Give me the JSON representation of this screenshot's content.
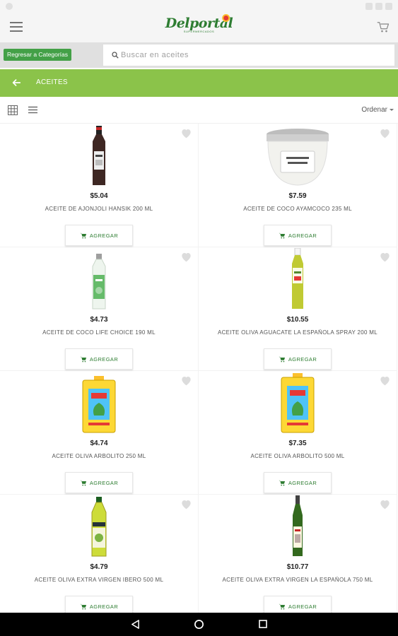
{
  "app": {
    "logo_text": "Delportal",
    "logo_subtitle": "SUPERMERCADOS"
  },
  "header": {
    "menu_icon": "hamburger-menu-icon",
    "cart_icon": "shopping-cart-icon"
  },
  "search": {
    "back_to_categories_label": "Regresar a Categorías",
    "placeholder": "Buscar en aceites",
    "value": ""
  },
  "category": {
    "title": "ACEITES",
    "back_icon": "arrow-left-icon"
  },
  "toolbar": {
    "grid_view_icon": "grid-view-icon",
    "list_view_icon": "list-view-icon",
    "sort_label": "Ordenar"
  },
  "products": [
    {
      "price": "$5.04",
      "name": "ACEITE DE AJONJOLI HANSIK 200 ML",
      "add_label": "AGREGAR",
      "image": "dark-glass-bottle"
    },
    {
      "price": "$7.59",
      "name": "ACEITE DE COCO AYAMCOCO 235 ML",
      "add_label": "AGREGAR",
      "image": "coconut-oil-jar"
    },
    {
      "price": "$4.73",
      "name": "ACEITE DE COCO LIFE CHOICE 190 ML",
      "add_label": "AGREGAR",
      "image": "clear-bottle-green-label"
    },
    {
      "price": "$10.55",
      "name": "ACEITE OLIVA AGUACATE LA ESPAÑOLA SPRAY 200 ML",
      "add_label": "AGREGAR",
      "image": "spray-bottle"
    },
    {
      "price": "$4.74",
      "name": "ACEITE OLIVA ARBOLITO 250 ML",
      "add_label": "AGREGAR",
      "image": "yellow-tin-can"
    },
    {
      "price": "$7.35",
      "name": "ACEITE OLIVA ARBOLITO 500 ML",
      "add_label": "AGREGAR",
      "image": "yellow-tin-can"
    },
    {
      "price": "$4.79",
      "name": "ACEITE OLIVA EXTRA VIRGEN IBERO 500 ML",
      "add_label": "AGREGAR",
      "image": "olive-oil-bottle"
    },
    {
      "price": "$10.77",
      "name": "ACEITE OLIVA EXTRA VIRGEN LA ESPAÑOLA 750 ML",
      "add_label": "AGREGAR",
      "image": "tall-dark-green-bottle"
    }
  ],
  "colors": {
    "brand_green": "#8bc34a",
    "button_green": "#43a047",
    "text_green": "#2e7d32"
  },
  "navbar": {
    "back_icon": "nav-back-icon",
    "home_icon": "nav-home-icon",
    "recents_icon": "nav-recents-icon"
  }
}
